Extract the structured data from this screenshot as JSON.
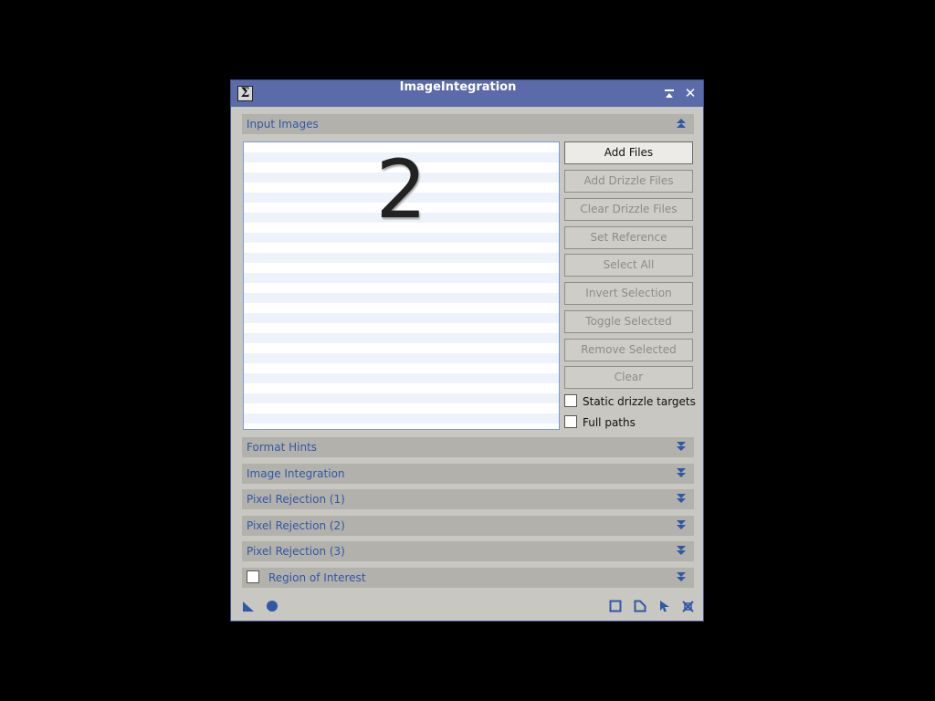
{
  "window": {
    "title": "ImageIntegration",
    "sigma_glyph": "Σ",
    "shade_glyph": "⏶",
    "close_glyph": "✕"
  },
  "input_images": {
    "title": "Input Images",
    "toggle_glyph": "⏶",
    "overlay_number": "2",
    "buttons": [
      {
        "label": "Add Files",
        "enabled": true
      },
      {
        "label": "Add Drizzle Files",
        "enabled": false
      },
      {
        "label": "Clear Drizzle Files",
        "enabled": false
      },
      {
        "label": "Set Reference",
        "enabled": false
      },
      {
        "label": "Select All",
        "enabled": false
      },
      {
        "label": "Invert Selection",
        "enabled": false
      },
      {
        "label": "Toggle Selected",
        "enabled": false
      },
      {
        "label": "Remove Selected",
        "enabled": false
      },
      {
        "label": "Clear",
        "enabled": false
      }
    ],
    "checkboxes": [
      {
        "label": "Static drizzle targets",
        "checked": false
      },
      {
        "label": "Full paths",
        "checked": false
      }
    ]
  },
  "sections": [
    {
      "title": "Format Hints",
      "glyph": "⏬"
    },
    {
      "title": "Image Integration",
      "glyph": "⏬"
    },
    {
      "title": "Pixel Rejection (1)",
      "glyph": "⏬"
    },
    {
      "title": "Pixel Rejection (2)",
      "glyph": "⏬"
    },
    {
      "title": "Pixel Rejection (3)",
      "glyph": "⏬"
    },
    {
      "title": "Region of Interest",
      "glyph": "⏬",
      "checkbox": false
    }
  ],
  "footer": {
    "left_icons": [
      "new-instance-icon",
      "apply-global-icon"
    ],
    "right_icons": [
      "reset-icon",
      "edit-instance-icon",
      "apply-icon",
      "close-process-icon"
    ]
  },
  "colors": {
    "titlebar": "#5b6baa",
    "section_text": "#2f58a8",
    "panel": "#c9c7c1"
  }
}
